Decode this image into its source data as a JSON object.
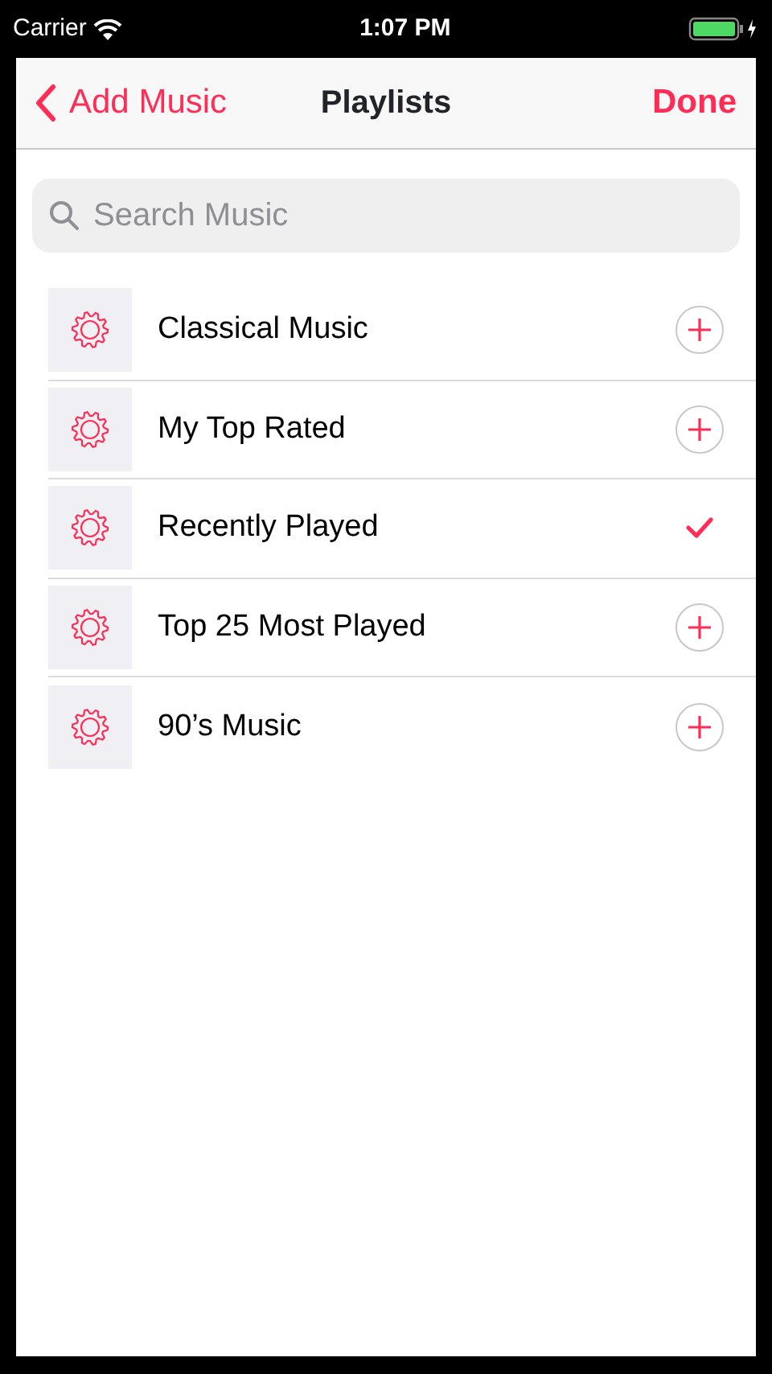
{
  "status_bar": {
    "carrier": "Carrier",
    "time": "1:07 PM"
  },
  "nav_bar": {
    "back": "Add Music",
    "title": "Playlists",
    "action": "Done"
  },
  "search": {
    "placeholder": "Search Music"
  },
  "playlists": [
    {
      "name": "Classical Music",
      "added": false
    },
    {
      "name": "My Top Rated",
      "added": false
    },
    {
      "name": "Recently Played",
      "added": true
    },
    {
      "name": "Top 25 Most Played",
      "added": false
    },
    {
      "name": "90’s Music",
      "added": false
    }
  ]
}
